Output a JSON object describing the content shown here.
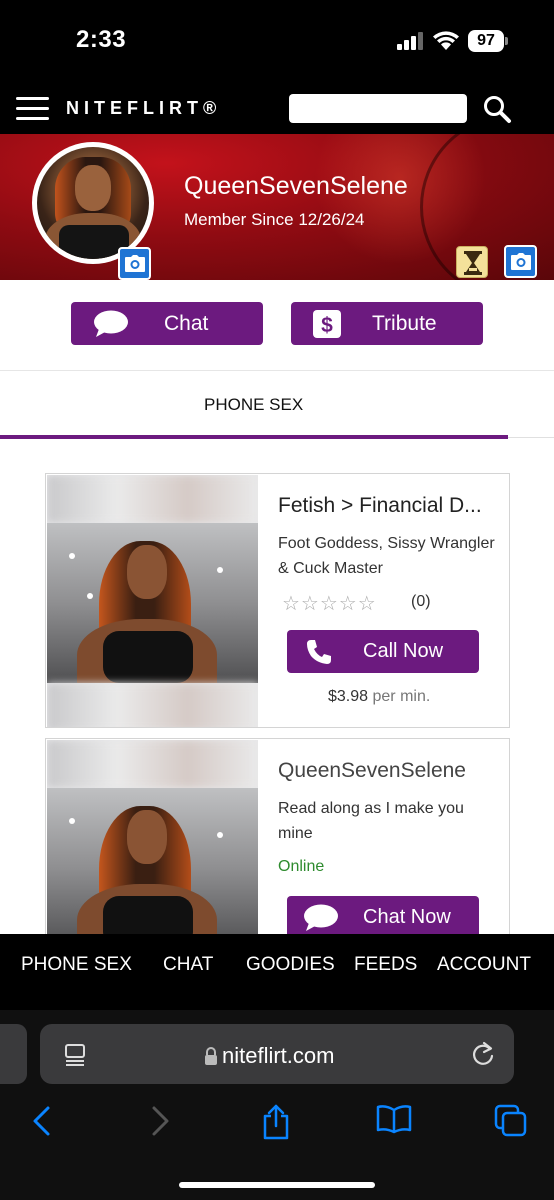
{
  "status_bar": {
    "time": "2:33",
    "battery_level": "97",
    "icons": [
      "signal-icon",
      "wifi-icon",
      "battery-icon"
    ]
  },
  "site_header": {
    "logo_text": "NITEFLIRT®",
    "search_placeholder": "",
    "icons": [
      "menu-icon",
      "search-icon"
    ]
  },
  "profile": {
    "name": "QueenSevenSelene",
    "member_since": "Member Since 12/26/24",
    "icons": [
      "camera-icon",
      "hourglass-icon"
    ]
  },
  "actions": {
    "chat_label": "Chat",
    "tribute_label": "Tribute",
    "icons": [
      "chat-bubble-icon",
      "dollar-icon"
    ]
  },
  "tabs": {
    "active": "PHONE SEX"
  },
  "listings": [
    {
      "title": "Fetish > Financial D...",
      "description": "Foot Goddess, Sissy Wrangler & Cuck Master",
      "stars": 0,
      "max_stars": 5,
      "rating_count": "(0)",
      "button_label": "Call Now",
      "price": "$3.98",
      "price_unit": "per min."
    },
    {
      "title": "QueenSevenSelene",
      "description": "Read along as I make you mine",
      "status": "Online",
      "button_label": "Chat Now"
    }
  ],
  "bottom_nav": {
    "items": [
      "PHONE SEX",
      "CHAT",
      "GOODIES",
      "FEEDS",
      "ACCOUNT"
    ]
  },
  "safari": {
    "url": "niteflirt.com",
    "icons": [
      "reader-icon",
      "lock-icon",
      "reload-icon",
      "back-icon",
      "forward-icon",
      "share-icon",
      "bookmarks-icon",
      "tabs-icon"
    ]
  },
  "colors": {
    "brand_purple": "#6c1a7f",
    "banner_red": "#a50f16",
    "online_green": "#2e8b2e",
    "safari_blue": "#0a84ff"
  }
}
